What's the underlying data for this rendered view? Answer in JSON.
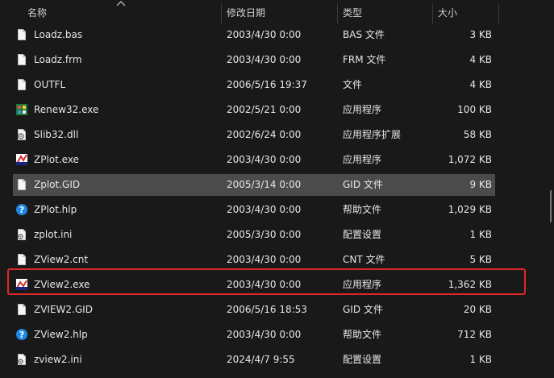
{
  "columns": {
    "name": "名称",
    "date": "修改日期",
    "type": "类型",
    "size": "大小"
  },
  "files": [
    {
      "name": "Loadz.bas",
      "date": "2003/4/30 0:00",
      "type": "BAS 文件",
      "size": "3 KB",
      "icon": "document-icon"
    },
    {
      "name": "Loadz.frm",
      "date": "2003/4/30 0:00",
      "type": "FRM 文件",
      "size": "4 KB",
      "icon": "document-icon"
    },
    {
      "name": "OUTFL",
      "date": "2006/5/16 19:37",
      "type": "文件",
      "size": "4 KB",
      "icon": "document-icon"
    },
    {
      "name": "Renew32.exe",
      "date": "2002/5/21 0:00",
      "type": "应用程序",
      "size": "100 KB",
      "icon": "renew-app-icon"
    },
    {
      "name": "Slib32.dll",
      "date": "2002/6/24 0:00",
      "type": "应用程序扩展",
      "size": "58 KB",
      "icon": "dll-gear-icon"
    },
    {
      "name": "ZPlot.exe",
      "date": "2003/4/30 0:00",
      "type": "应用程序",
      "size": "1,072 KB",
      "icon": "zplot-app-icon"
    },
    {
      "name": "Zplot.GID",
      "date": "2005/3/14 0:00",
      "type": "GID 文件",
      "size": "9 KB",
      "icon": "document-icon"
    },
    {
      "name": "ZPlot.hlp",
      "date": "2003/4/30 0:00",
      "type": "帮助文件",
      "size": "1,029 KB",
      "icon": "help-icon"
    },
    {
      "name": "zplot.ini",
      "date": "2005/3/30 0:00",
      "type": "配置设置",
      "size": "1 KB",
      "icon": "settings-file-icon"
    },
    {
      "name": "ZView2.cnt",
      "date": "2003/4/30 0:00",
      "type": "CNT 文件",
      "size": "5 KB",
      "icon": "document-icon"
    },
    {
      "name": "ZView2.exe",
      "date": "2003/4/30 0:00",
      "type": "应用程序",
      "size": "1,362 KB",
      "icon": "zview-app-icon"
    },
    {
      "name": "ZVIEW2.GID",
      "date": "2006/5/16 18:53",
      "type": "GID 文件",
      "size": "20 KB",
      "icon": "document-icon"
    },
    {
      "name": "ZView2.hlp",
      "date": "2003/4/30 0:00",
      "type": "帮助文件",
      "size": "712 KB",
      "icon": "help-icon"
    },
    {
      "name": "zview2.ini",
      "date": "2024/4/7 9:55",
      "type": "配置设置",
      "size": "1 KB",
      "icon": "settings-file-icon"
    }
  ],
  "selected_index": 6,
  "highlighted_index": 10,
  "colors": {
    "background": "#191919",
    "selected_row": "#4b4b4b",
    "highlight_border": "#e0272a",
    "help_icon": "#1e88e5"
  }
}
